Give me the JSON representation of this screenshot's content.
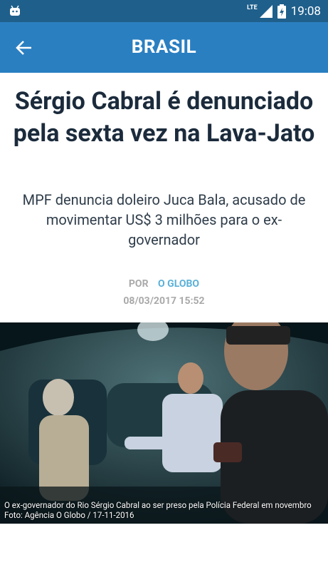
{
  "status": {
    "network": "LTE",
    "time": "19:08"
  },
  "appbar": {
    "title": "BRASIL"
  },
  "article": {
    "headline": "Sérgio Cabral é denunciado pela sexta vez na Lava-Jato",
    "subheadline": "MPF denuncia doleiro Juca Bala, acusado de movimentar US$ 3 milhões para o ex-governador",
    "byline_prefix": "POR",
    "source": "O GLOBO",
    "date": "08/03/2017 15:52"
  },
  "photo": {
    "caption": "O ex-governador do Rio Sérgio Cabral ao ser preso pela Polícia Federal em novembro",
    "credit": "Foto: Agência O Globo / 17-11-2016"
  }
}
